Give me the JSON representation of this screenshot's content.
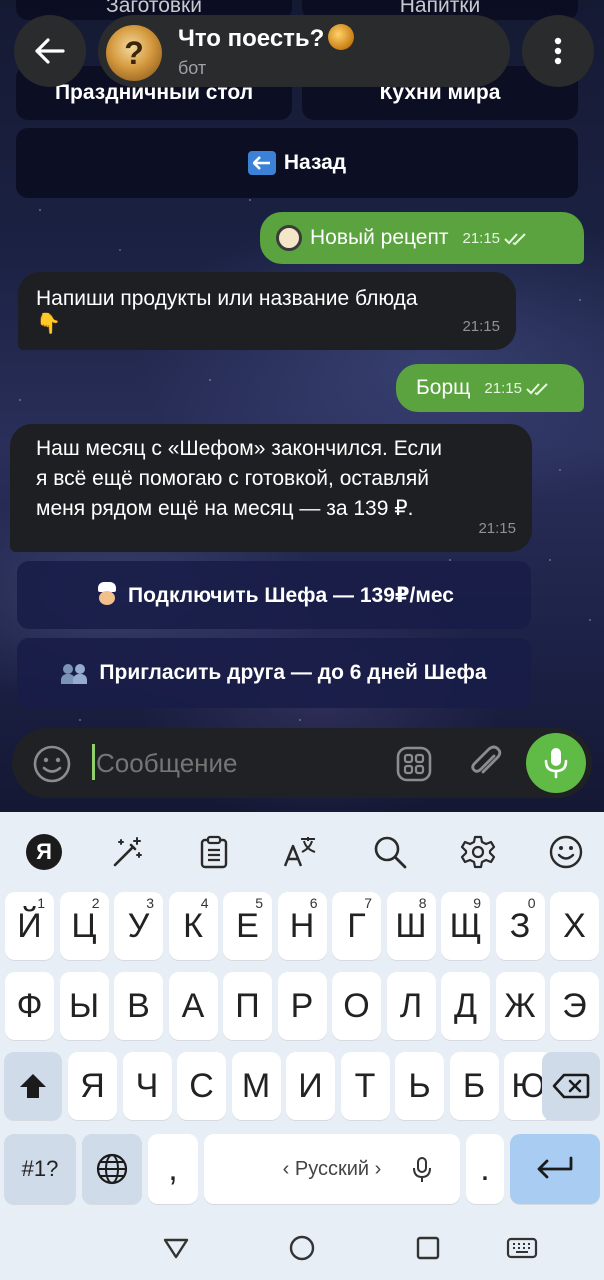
{
  "header": {
    "title": "Что поесть?",
    "subtitle": "бот"
  },
  "top_keyboard": {
    "row0": [
      "Заготовки",
      "Напитки"
    ],
    "row1": [
      "Праздничный стол",
      "Кухни мира"
    ],
    "back_label": "Назад"
  },
  "messages": [
    {
      "dir": "out",
      "text": "Новый рецепт",
      "time": "21:15"
    },
    {
      "dir": "in",
      "text_line1": "Напиши продукты или название блюда",
      "emoji": "👇",
      "time": "21:15"
    },
    {
      "dir": "out",
      "text": "Борщ",
      "time": "21:15"
    },
    {
      "dir": "in",
      "lines": [
        "Наш месяц с «Шефом» закончился. Если",
        "я всё ещё помогаю с готовкой, оставляй",
        "меня рядом ещё на месяц — за 139 ₽."
      ],
      "time": "21:15"
    }
  ],
  "inline_buttons": {
    "subscribe": "Подключить Шефа — 139₽/мес",
    "invite": "Пригласить друга — до 6 дней Шефа"
  },
  "composer": {
    "placeholder": "Сообщение"
  },
  "keyboard": {
    "row1": [
      {
        "k": "Й",
        "n": "1"
      },
      {
        "k": "Ц",
        "n": "2"
      },
      {
        "k": "У",
        "n": "3"
      },
      {
        "k": "К",
        "n": "4"
      },
      {
        "k": "Е",
        "n": "5"
      },
      {
        "k": "Н",
        "n": "6"
      },
      {
        "k": "Г",
        "n": "7"
      },
      {
        "k": "Ш",
        "n": "8"
      },
      {
        "k": "Щ",
        "n": "9"
      },
      {
        "k": "З",
        "n": "0"
      },
      {
        "k": "Х",
        "n": ""
      }
    ],
    "row2": [
      "Ф",
      "Ы",
      "В",
      "А",
      "П",
      "Р",
      "О",
      "Л",
      "Д",
      "Ж",
      "Э"
    ],
    "row3": [
      "Я",
      "Ч",
      "С",
      "М",
      "И",
      "Т",
      "Ь",
      "Б",
      "Ю"
    ],
    "symbols_key": "#1?",
    "comma": ",",
    "period": ".",
    "space_label": "‹ Русский ›",
    "yandex_logo": "Я"
  }
}
